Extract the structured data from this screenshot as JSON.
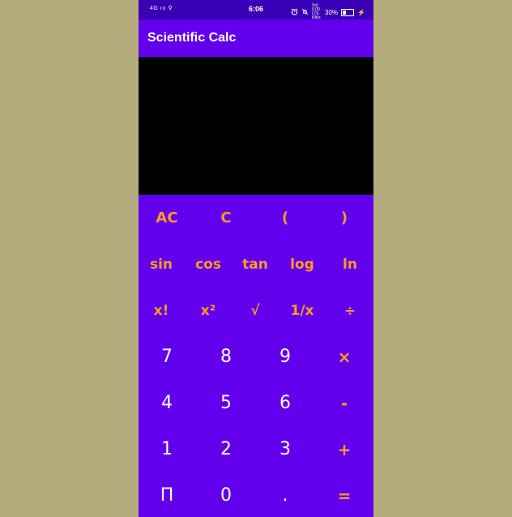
{
  "status_bar": {
    "left": "4G ııı ⚲",
    "time": "6:06",
    "network": "Vo) 0.00 LTE KB/s",
    "battery": "30%",
    "battery_level": 0.3,
    "icons": [
      "alarm-icon",
      "mute-icon",
      "battery-icon",
      "charging-icon"
    ]
  },
  "app": {
    "title": "Scientific Calc"
  },
  "display": {
    "expression": "",
    "result": ""
  },
  "keys": {
    "row1": [
      "AC",
      "C",
      "(",
      ")"
    ],
    "row2": [
      "sin",
      "cos",
      "tan",
      "log",
      "ln"
    ],
    "row3": [
      "x!",
      "x²",
      "√",
      "1/x",
      "÷"
    ],
    "row4": [
      "7",
      "8",
      "9",
      "×"
    ],
    "row5": [
      "4",
      "5",
      "6",
      "-"
    ],
    "row6": [
      "1",
      "2",
      "3",
      "+"
    ],
    "row7": [
      "Π",
      "0",
      ".",
      "="
    ]
  },
  "colors": {
    "primary": "#6200ee",
    "status_bar": "#3a00b5",
    "accent": "#ff9a1f",
    "display_bg": "#000000",
    "number_text": "#ffffff",
    "background": "#b6ab7c"
  }
}
